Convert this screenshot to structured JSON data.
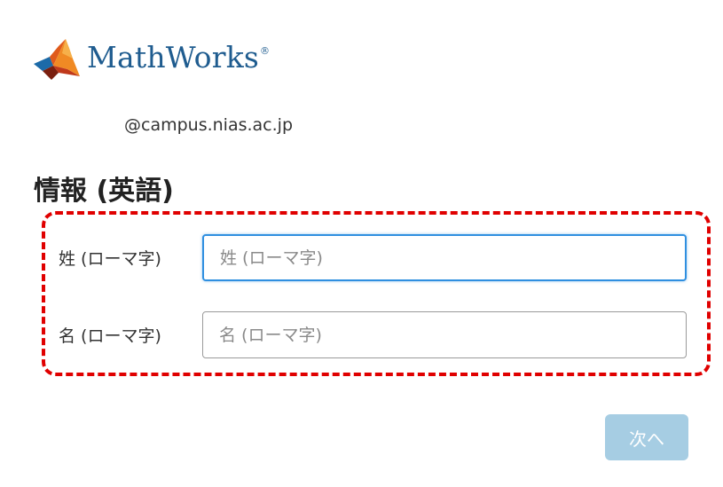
{
  "brand": {
    "logo_icon": "mathworks-membrane-logo",
    "name": "MathWorks",
    "registered_mark": "®",
    "name_color": "#1f5c8f"
  },
  "account": {
    "email_domain": "@campus.nias.ac.jp"
  },
  "form": {
    "section_title": "情報 (英語)",
    "highlight_color": "#e00000",
    "fields": [
      {
        "label": "姓 (ローマ字)",
        "value": "",
        "placeholder": "姓 (ローマ字)",
        "focused": true
      },
      {
        "label": "名 (ローマ字)",
        "value": "",
        "placeholder": "名 (ローマ字)",
        "focused": false
      }
    ],
    "focus_color": "#2f8fe0"
  },
  "actions": {
    "next_label": "次へ",
    "next_enabled": false,
    "next_color": "#a6cde3"
  }
}
